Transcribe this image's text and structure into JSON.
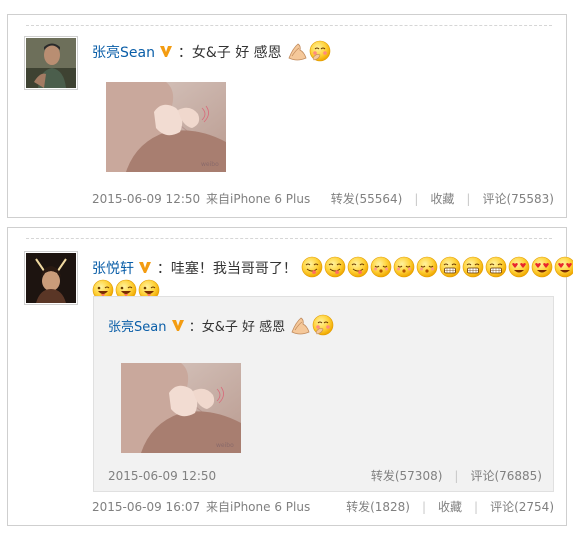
{
  "posts": [
    {
      "author": "张亮Sean",
      "text": "：女&子 好 感恩",
      "emojis": [
        "pray-hands-icon",
        "shy-face-icon"
      ],
      "time": "2015-06-09 12:50",
      "source": "来自iPhone 6 Plus",
      "repost": "转发(55564)",
      "favorite": "收藏",
      "comment": "评论(75583)"
    },
    {
      "author": "张悦轩",
      "text": "：哇塞！我当哥哥了！",
      "emojis_row1": [
        "tongue-face-icon",
        "tongue-face-icon",
        "tongue-face-icon",
        "kiss-face-icon",
        "kiss-face-icon",
        "kiss-face-icon",
        "grin-face-icon",
        "grin-face-icon",
        "grin-face-icon",
        "heart-eyes-icon",
        "heart-eyes-icon",
        "heart-eyes-icon"
      ],
      "emojis_row2": [
        "wink-tongue-icon",
        "wink-tongue-icon",
        "wink-tongue-icon"
      ],
      "time": "2015-06-09 16:07",
      "source": "来自iPhone 6 Plus",
      "repost": "转发(1828)",
      "favorite": "收藏",
      "comment": "评论(2754)",
      "quoted": {
        "author": "张亮Sean",
        "text": "：女&子 好 感恩",
        "time": "2015-06-09 12:50",
        "repost": "转发(57308)",
        "comment": "评论(76885)"
      }
    }
  ],
  "colors": {
    "name": "#0a5ea8",
    "meta": "#808080",
    "badge": "#f39c12",
    "quote_bg": "#f2f2f2"
  }
}
